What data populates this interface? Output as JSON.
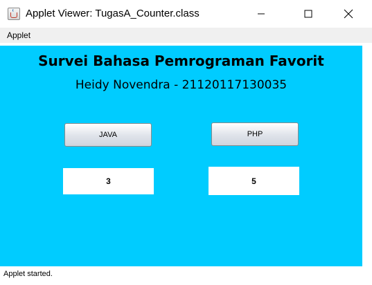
{
  "window": {
    "title": "Applet Viewer: TugasA_Counter.class"
  },
  "menubar": {
    "items": [
      {
        "label": "Applet"
      }
    ]
  },
  "applet": {
    "heading": "Survei Bahasa Pemrograman Favorit",
    "subheading": "Heidy Novendra - 21120117130035",
    "background_color": "#00ccff",
    "buttons": {
      "java_label": "JAVA",
      "php_label": "PHP"
    },
    "counters": {
      "java_value": "3",
      "php_value": "5"
    }
  },
  "status": {
    "text": "Applet started."
  },
  "icons": {
    "app": "java-cup-icon",
    "minimize": "minimize-icon",
    "maximize": "maximize-icon",
    "close": "close-icon"
  }
}
